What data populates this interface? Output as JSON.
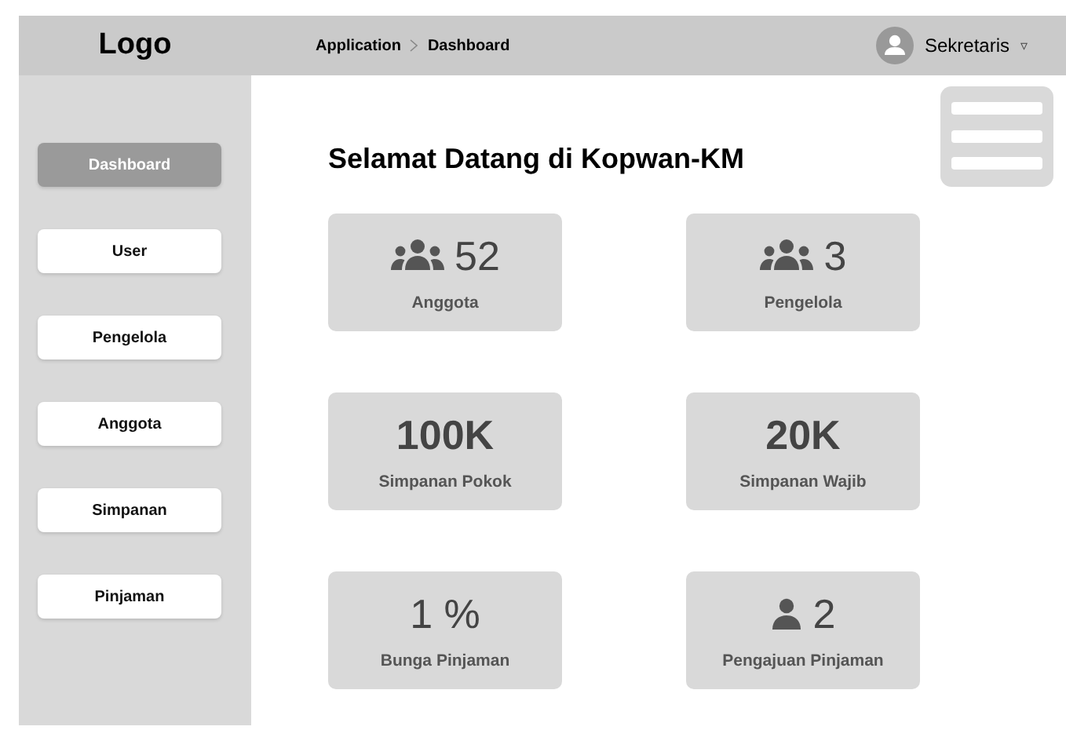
{
  "header": {
    "logo": "Logo",
    "breadcrumb": [
      "Application",
      "Dashboard"
    ],
    "user": "Sekretaris",
    "menu_caret": "▿"
  },
  "sidebar": {
    "items": [
      {
        "label": "Dashboard",
        "selected": true
      },
      {
        "label": "User",
        "selected": false
      },
      {
        "label": "Pengelola",
        "selected": false
      },
      {
        "label": "Anggota",
        "selected": false
      },
      {
        "label": "Simpanan",
        "selected": false
      },
      {
        "label": "Pinjaman",
        "selected": false
      }
    ]
  },
  "main": {
    "title": "Selamat Datang di Kopwan-KM",
    "cards": [
      {
        "kind": "group",
        "value": "52",
        "label": "Anggota"
      },
      {
        "kind": "group",
        "value": "3",
        "label": "Pengelola"
      },
      {
        "kind": "big",
        "value": "100K",
        "label": "Simpanan Pokok"
      },
      {
        "kind": "big",
        "value": "20K",
        "label": "Simpanan Wajib"
      },
      {
        "kind": "plain",
        "value": "1 %",
        "label": "Bunga Pinjaman"
      },
      {
        "kind": "person",
        "value": "2",
        "label": "Pengajuan Pinjaman"
      }
    ]
  }
}
